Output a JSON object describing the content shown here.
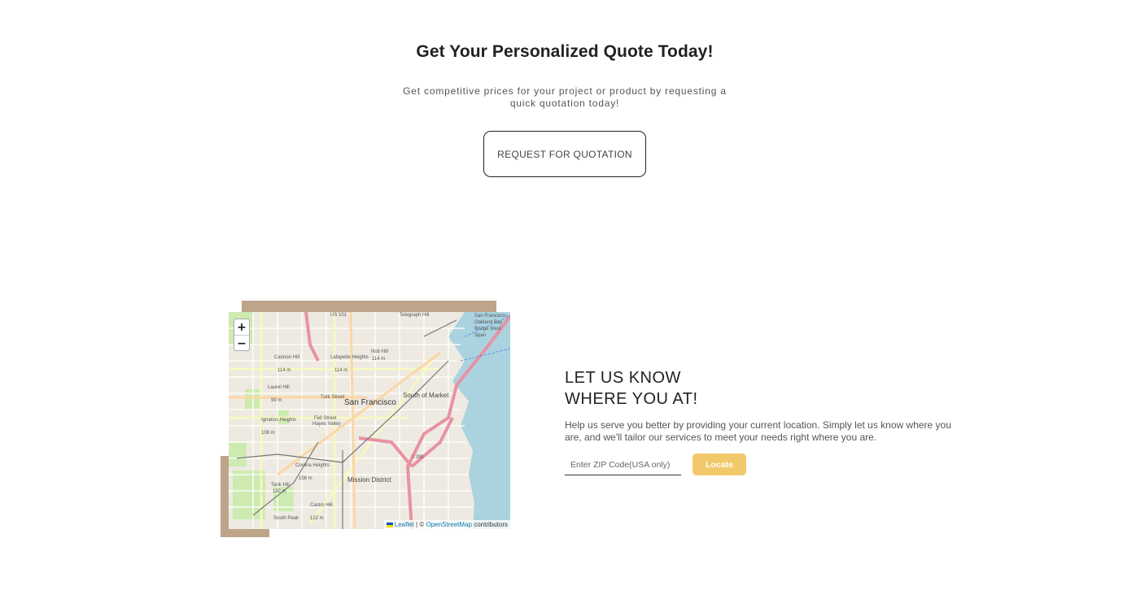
{
  "quote": {
    "title": "Get Your Personalized Quote Today!",
    "subtitle": "Get competitive prices for your project or product by requesting a quick quotation today!",
    "button_label": "REQUEST FOR QUOTATION"
  },
  "map": {
    "zoom_in": "+",
    "zoom_out": "−",
    "labels": {
      "city": "San Francisco",
      "south_of_market": "South of Market",
      "mission_district": "Mission District",
      "telegraph_hill": "Telegraph Hill",
      "cannon_hill": "Cannon Hill",
      "cannon_elev": "114 m",
      "lafayette": "Lafayette Heights",
      "lafayette_elev": "114 m",
      "nob_hill": "Nob Hill",
      "nob_elev": "114 m",
      "laurel_hill": "Laurel Hill",
      "laurel_elev": "99 m",
      "ignatius": "Ignatius Heights",
      "ignatius_elev": "108 m",
      "hayes": "Hayes Valley",
      "corona": "Corona Heights",
      "corona_elev": "158 m",
      "tank_hill": "Tank Hill",
      "tank_elev": "182 m",
      "castro": "Castro Hill",
      "castro_elev": "122 m",
      "south_peak": "South Peak",
      "oakland": "San Francisco–Oakland Bay Bridge West Span",
      "us101": "US 101",
      "i280": "I 280",
      "turk": "Turk Street",
      "fell": "Fell Street"
    },
    "attribution": {
      "leaflet": "Leaflet",
      "separator": "| ©",
      "osm": "OpenStreetMap",
      "contributors": "contributors"
    }
  },
  "location": {
    "title_line1": "LET US KNOW",
    "title_line2": "WHERE YOU AT!",
    "description": "Help us serve you better by providing your current location. Simply let us know where you are, and we'll tailor our services to meet your needs right where you are.",
    "zip_placeholder": "Enter ZIP Code(USA only)",
    "zip_value": "",
    "locate_label": "Locate"
  },
  "colors": {
    "frame": "#bea589",
    "locate_button": "#f2c96a",
    "map_water": "#aad3df",
    "map_land": "#eeeae2"
  }
}
